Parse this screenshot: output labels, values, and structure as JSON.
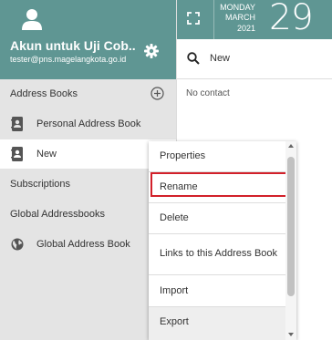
{
  "account": {
    "name": "Akun untuk Uji Cob...",
    "email": "tester@pns.magelangkota.go.id"
  },
  "date": {
    "weekday": "MONDAY",
    "month": "MARCH",
    "year": "2021",
    "day": "29"
  },
  "sidebar": {
    "address_books_label": "Address Books",
    "books": [
      {
        "label": "Personal Address Book",
        "icon": "contact-card-icon"
      },
      {
        "label": "New",
        "icon": "contact-card-icon"
      }
    ],
    "subscriptions_label": "Subscriptions",
    "global_label": "Global Addressbooks",
    "global_books": [
      {
        "label": "Global Address Book",
        "icon": "globe-icon"
      }
    ]
  },
  "main": {
    "search_value": "New",
    "empty_text": "No contact"
  },
  "context_menu": {
    "items": [
      "Properties",
      "Rename",
      "Delete",
      "Links to this Address Book",
      "Import",
      "Export"
    ],
    "highlighted": "Rename"
  },
  "colors": {
    "accent": "#5f9693",
    "highlight_border": "#d2202a"
  }
}
